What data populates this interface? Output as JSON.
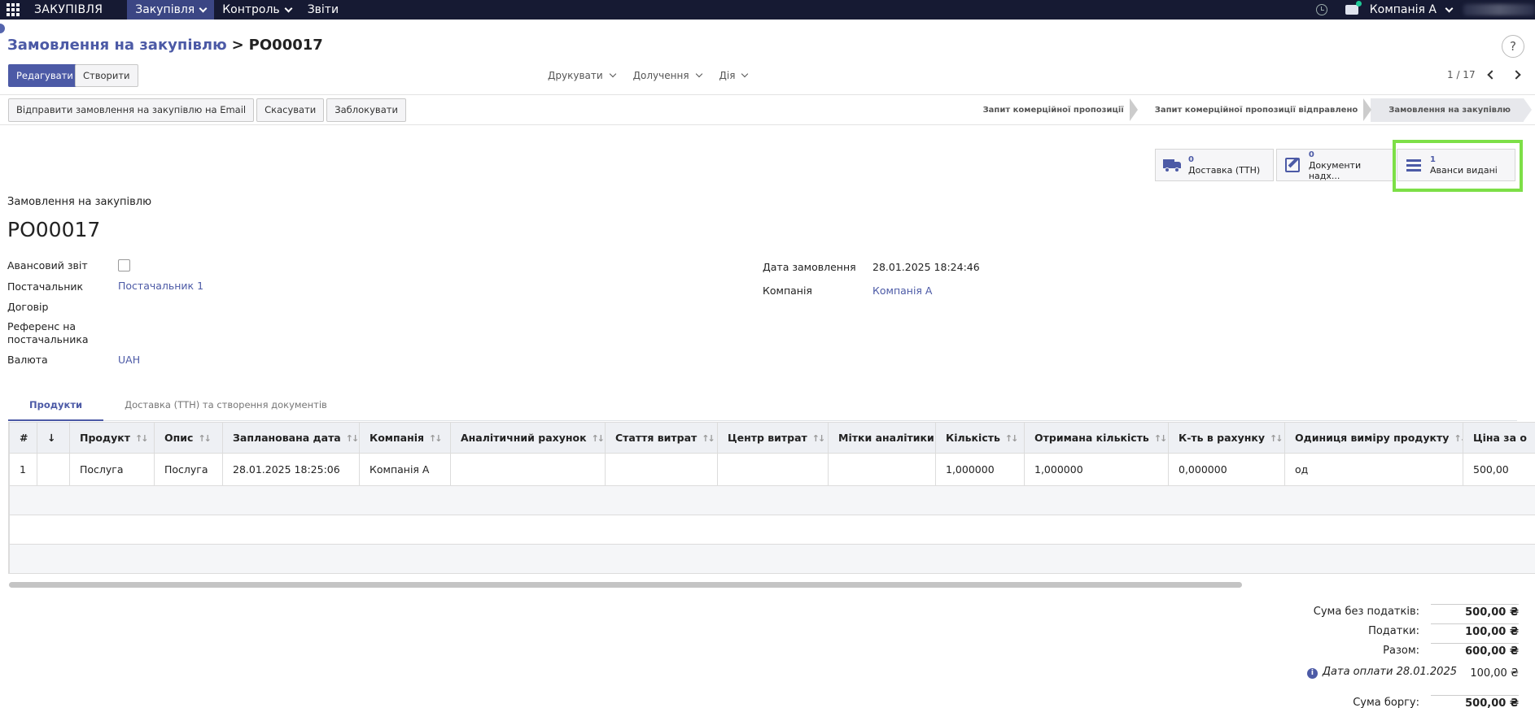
{
  "navbar": {
    "brand": "ЗАКУПІВЛЯ",
    "menu": [
      {
        "label": "Закупівля",
        "active": true,
        "dropdown": true
      },
      {
        "label": "Контроль",
        "active": false,
        "dropdown": true
      },
      {
        "label": "Звіти",
        "active": false,
        "dropdown": false
      }
    ],
    "company": "Компанія А"
  },
  "breadcrumb": {
    "parent": "Замовлення на закупівлю",
    "sep": ">",
    "current": "PO00017"
  },
  "help": "?",
  "actions": {
    "edit": "Редагувати",
    "create": "Створити"
  },
  "dropdowns": [
    "Друкувати",
    "Долучення",
    "Дія"
  ],
  "pager": {
    "value": "1 / 17"
  },
  "status_buttons": [
    "Відправити замовлення на закупівлю на Email",
    "Скасувати",
    "Заблокувати"
  ],
  "status_steps": [
    {
      "label": "Запит комерційної пропозиції",
      "current": false
    },
    {
      "label": "Запит комерційної пропозиції відправлено",
      "current": false
    },
    {
      "label": "Замовлення на закупівлю",
      "current": true
    }
  ],
  "smart_buttons": {
    "delivery": {
      "count": "0",
      "label": "Доставка (ТТН)"
    },
    "documents": {
      "count": "0",
      "label": "Документи надх..."
    },
    "advances": {
      "count": "1",
      "label": "Аванси видані"
    }
  },
  "form": {
    "subtitle": "Замовлення на закупівлю",
    "title": "PO00017",
    "advance_report_label": "Авансовий звіт",
    "advance_report_checked": false,
    "vendor_label": "Постачальник",
    "vendor_value": "Постачальник 1",
    "contract_label": "Договір",
    "vendor_ref_label_1": "Референс на",
    "vendor_ref_label_2": "постачальника",
    "currency_label": "Валюта",
    "currency_value": "UAH",
    "order_date_label": "Дата замовлення",
    "order_date_value": "28.01.2025 18:24:46",
    "company_label": "Компанія",
    "company_value": "Компанія А"
  },
  "tabs": [
    "Продукти",
    "Доставка (ТТН) та створення документів"
  ],
  "table": {
    "headers": [
      "#",
      "↓",
      "Продукт",
      "Опис",
      "Запланована дата",
      "Компанія",
      "Аналітичний рахунок",
      "Стаття витрат",
      "Центр витрат",
      "Мітки аналітики",
      "Кількість",
      "Отримана кількість",
      "К-ть в рахунку",
      "Одиниця виміру продукту",
      "Ціна за о"
    ],
    "rows": [
      [
        "1",
        "",
        "Послуга",
        "Послуга",
        "28.01.2025 18:25:06",
        "Компанія А",
        "",
        "",
        "",
        "",
        "1,000000",
        "1,000000",
        "0,000000",
        "од",
        "500,00"
      ]
    ]
  },
  "totals": {
    "untaxed_label": "Сума без податків:",
    "untaxed_value": "500,00 ₴",
    "taxes_label": "Податки:",
    "taxes_value": "100,00 ₴",
    "total_label": "Разом:",
    "total_value": "600,00 ₴",
    "payment_label": "Дата оплати 28.01.2025",
    "payment_value": "100,00 ₴",
    "debt_label": "Сума боргу:",
    "debt_value": "500,00 ₴"
  }
}
